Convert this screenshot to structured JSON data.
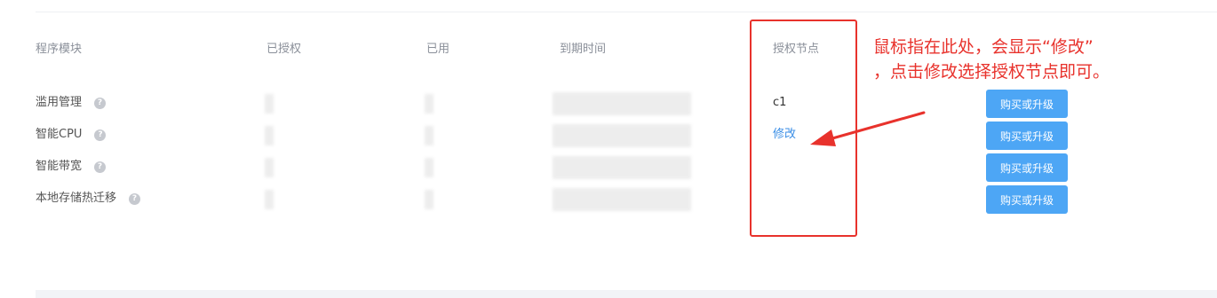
{
  "table": {
    "headers": {
      "module": "程序模块",
      "authorized": "已授权",
      "used": "已用",
      "expiry": "到期时间",
      "node": "授权节点"
    },
    "rows": [
      {
        "module": "滥用管理",
        "help_icon": "question-circle-icon",
        "node": "c1",
        "buy_label": "购买或升级"
      },
      {
        "module": "智能CPU",
        "help_icon": "question-circle-icon",
        "node_action": "修改",
        "buy_label": "购买或升级"
      },
      {
        "module": "智能带宽",
        "help_icon": "question-circle-icon",
        "buy_label": "购买或升级"
      },
      {
        "module": "本地存储热迁移",
        "help_icon": "question-circle-icon",
        "buy_label": "购买或升级"
      }
    ]
  },
  "help_glyph": "?",
  "annotation": {
    "line1": "鼠标指在此处，会显示“修改”",
    "line2": "，点击修改选择授权节点即可。",
    "color": "#e8322c"
  },
  "colors": {
    "button": "#4da6f5",
    "link": "#3a8ee6",
    "header_text": "#8a8f99"
  }
}
